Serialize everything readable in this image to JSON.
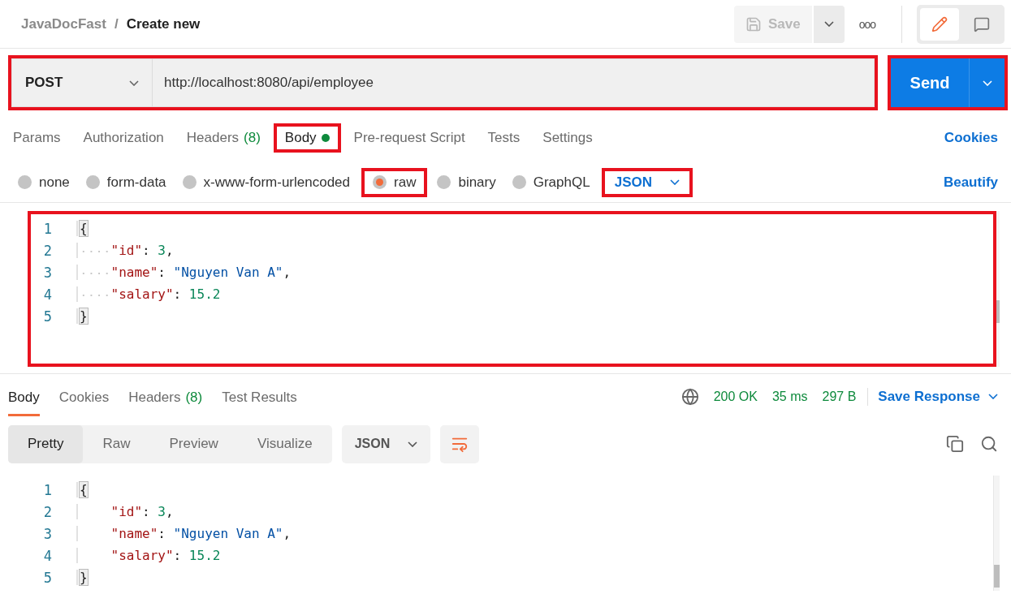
{
  "breadcrumb": {
    "collection": "JavaDocFast",
    "separator": "/",
    "request": "Create new"
  },
  "toolbar": {
    "save": {
      "label": "Save",
      "disabled": true
    },
    "more": "ooo",
    "modes": [
      {
        "kind": "edit",
        "selected": true
      },
      {
        "kind": "comments",
        "selected": false
      }
    ]
  },
  "request": {
    "method": "POST",
    "url": "http://localhost:8080/api/employee",
    "highlighted": true,
    "send": {
      "label": "Send",
      "highlighted": true
    }
  },
  "request_tabs": [
    {
      "label": "Params",
      "selected": false,
      "highlighted": false
    },
    {
      "label": "Authorization",
      "selected": false,
      "highlighted": false
    },
    {
      "label": "Headers",
      "count": "(8)",
      "selected": false,
      "highlighted": false
    },
    {
      "label": "Body",
      "has_content": true,
      "selected": true,
      "highlighted": true
    },
    {
      "label": "Pre-request Script",
      "selected": false,
      "highlighted": false
    },
    {
      "label": "Tests",
      "selected": false,
      "highlighted": false
    },
    {
      "label": "Settings",
      "selected": false,
      "highlighted": false
    }
  ],
  "cookies_link": "Cookies",
  "body_types": [
    {
      "label": "none",
      "selected": false,
      "highlighted": false
    },
    {
      "label": "form-data",
      "selected": false,
      "highlighted": false
    },
    {
      "label": "x-www-form-urlencoded",
      "selected": false,
      "highlighted": false
    },
    {
      "label": "raw",
      "selected": true,
      "highlighted": true
    },
    {
      "label": "binary",
      "selected": false,
      "highlighted": false
    },
    {
      "label": "GraphQL",
      "selected": false,
      "highlighted": false
    }
  ],
  "body_language": {
    "label": "JSON",
    "highlighted": true
  },
  "beautify_link": "Beautify",
  "request_editor": {
    "highlighted": true,
    "show_whitespace": true,
    "lines": [
      {
        "number": "1",
        "tokens": [
          {
            "kind": "bracket",
            "text": "{"
          }
        ]
      },
      {
        "number": "2",
        "tokens": [
          {
            "kind": "indent"
          },
          {
            "kind": "key",
            "text": "\"id\""
          },
          {
            "kind": "punct",
            "text": ": "
          },
          {
            "kind": "number",
            "text": "3"
          },
          {
            "kind": "punct",
            "text": ","
          }
        ]
      },
      {
        "number": "3",
        "tokens": [
          {
            "kind": "indent"
          },
          {
            "kind": "key",
            "text": "\"name\""
          },
          {
            "kind": "punct",
            "text": ": "
          },
          {
            "kind": "string",
            "text": "\"Nguyen Van A\""
          },
          {
            "kind": "punct",
            "text": ","
          }
        ]
      },
      {
        "number": "4",
        "tokens": [
          {
            "kind": "indent"
          },
          {
            "kind": "key",
            "text": "\"salary\""
          },
          {
            "kind": "punct",
            "text": ": "
          },
          {
            "kind": "number",
            "text": "15.2"
          }
        ]
      },
      {
        "number": "5",
        "tokens": [
          {
            "kind": "bracket",
            "text": "}"
          }
        ]
      }
    ]
  },
  "response_tabs": [
    {
      "label": "Body",
      "selected": true
    },
    {
      "label": "Cookies",
      "selected": false
    },
    {
      "label": "Headers",
      "count": "(8)",
      "selected": false
    },
    {
      "label": "Test Results",
      "selected": false
    }
  ],
  "response_status": {
    "status": "200 OK",
    "time": "35 ms",
    "size": "297 B"
  },
  "save_response": "Save Response",
  "view_modes": [
    {
      "label": "Pretty",
      "selected": true
    },
    {
      "label": "Raw",
      "selected": false
    },
    {
      "label": "Preview",
      "selected": false
    },
    {
      "label": "Visualize",
      "selected": false
    }
  ],
  "response_language": "JSON",
  "response_editor": {
    "highlighted": false,
    "show_whitespace": false,
    "lines": [
      {
        "number": "1",
        "tokens": [
          {
            "kind": "bracket",
            "text": "{"
          }
        ]
      },
      {
        "number": "2",
        "tokens": [
          {
            "kind": "indent"
          },
          {
            "kind": "key",
            "text": "\"id\""
          },
          {
            "kind": "punct",
            "text": ": "
          },
          {
            "kind": "number",
            "text": "3"
          },
          {
            "kind": "punct",
            "text": ","
          }
        ]
      },
      {
        "number": "3",
        "tokens": [
          {
            "kind": "indent"
          },
          {
            "kind": "key",
            "text": "\"name\""
          },
          {
            "kind": "punct",
            "text": ": "
          },
          {
            "kind": "string",
            "text": "\"Nguyen Van A\""
          },
          {
            "kind": "punct",
            "text": ","
          }
        ]
      },
      {
        "number": "4",
        "tokens": [
          {
            "kind": "indent"
          },
          {
            "kind": "key",
            "text": "\"salary\""
          },
          {
            "kind": "punct",
            "text": ": "
          },
          {
            "kind": "number",
            "text": "15.2"
          }
        ]
      },
      {
        "number": "5",
        "tokens": [
          {
            "kind": "bracket",
            "text": "}"
          }
        ]
      }
    ]
  }
}
